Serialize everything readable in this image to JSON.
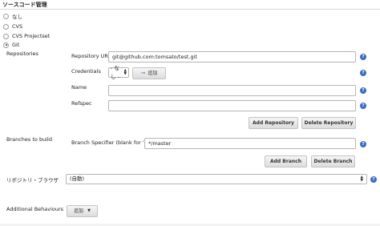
{
  "section_title": "ソースコード管理",
  "scm_options": [
    {
      "label": "なし",
      "checked": false
    },
    {
      "label": "CVS",
      "checked": false
    },
    {
      "label": "CVS Projectset",
      "checked": false
    },
    {
      "label": "Git",
      "checked": true
    }
  ],
  "repositories": {
    "label": "Repositories",
    "url_label": "Repository URL",
    "url_value": "git@github.com:tomsato/test.git",
    "credentials_label": "Credentials",
    "credentials_value": "- なし -",
    "add_credentials_label": "追加",
    "name_label": "Name",
    "name_value": "",
    "refspec_label": "Refspec",
    "refspec_value": "",
    "add_repository_label": "Add Repository",
    "delete_repository_label": "Delete Repository"
  },
  "branches": {
    "label": "Branches to build",
    "specifier_label": "Branch Specifier (blank for 'any')",
    "specifier_value": "*/master",
    "add_branch_label": "Add Branch",
    "delete_branch_label": "Delete Branch"
  },
  "browser": {
    "label": "リポジトリ・ブラウザ",
    "value": "(自動)"
  },
  "additional": {
    "label": "Additional Behaviours",
    "add_label": "追加"
  },
  "help_glyph": "?",
  "colors": {
    "help": "#3a6bc5",
    "border": "#b5b5b5"
  }
}
